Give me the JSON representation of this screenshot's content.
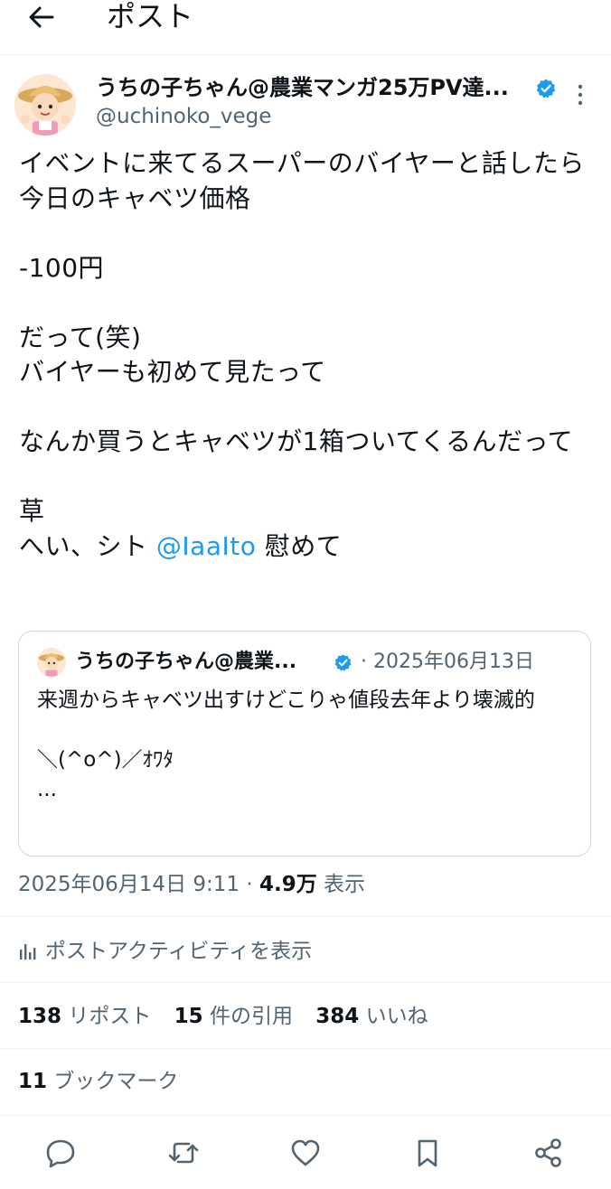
{
  "header": {
    "title": "ポスト"
  },
  "post": {
    "author": {
      "display_name": "うちの子ちゃん@農業マンガ25万PV達...",
      "handle": "@uchinoko_vege",
      "verified": true
    },
    "text_main": "イベントに来てるスーパーのバイヤーと話したら今日のキャベツ価格\n\n-100円\n\nだって(笑)\nバイヤーも初めて見たって\n\nなんか買うとキャベツが1箱ついてくるんだって\n\n草\nへい、シト ",
    "mention": "@IaaIto",
    "text_after_mention": " 慰めて",
    "quote": {
      "display_name": "うちの子ちゃん@農業...",
      "separator": "·",
      "date": "2025年06月13日",
      "text": "来週からキャベツ出すけどこりゃ値段去年より壊滅的\n\n＼(^o^)／ｵﾜﾀ\n..."
    },
    "timestamp": "2025年06月14日 9:11",
    "separator": "·",
    "views_count": "4.9万",
    "views_label": "表示",
    "activity_label": "ポストアクティビティを表示",
    "stats": {
      "reposts_count": "138",
      "reposts_label": "リポスト",
      "quotes_count": "15",
      "quotes_label": "件の引用",
      "likes_count": "384",
      "likes_label": "いいね",
      "bookmarks_count": "11",
      "bookmarks_label": "ブックマーク"
    }
  },
  "colors": {
    "accent": "#1d9bf0",
    "secondary_text": "#536471",
    "divider": "#eff3f4"
  },
  "icons": [
    "back-arrow-icon",
    "verified-badge-icon",
    "more-vertical-icon",
    "analytics-icon",
    "reply-icon",
    "retweet-icon",
    "like-icon",
    "bookmark-icon",
    "share-icon"
  ]
}
